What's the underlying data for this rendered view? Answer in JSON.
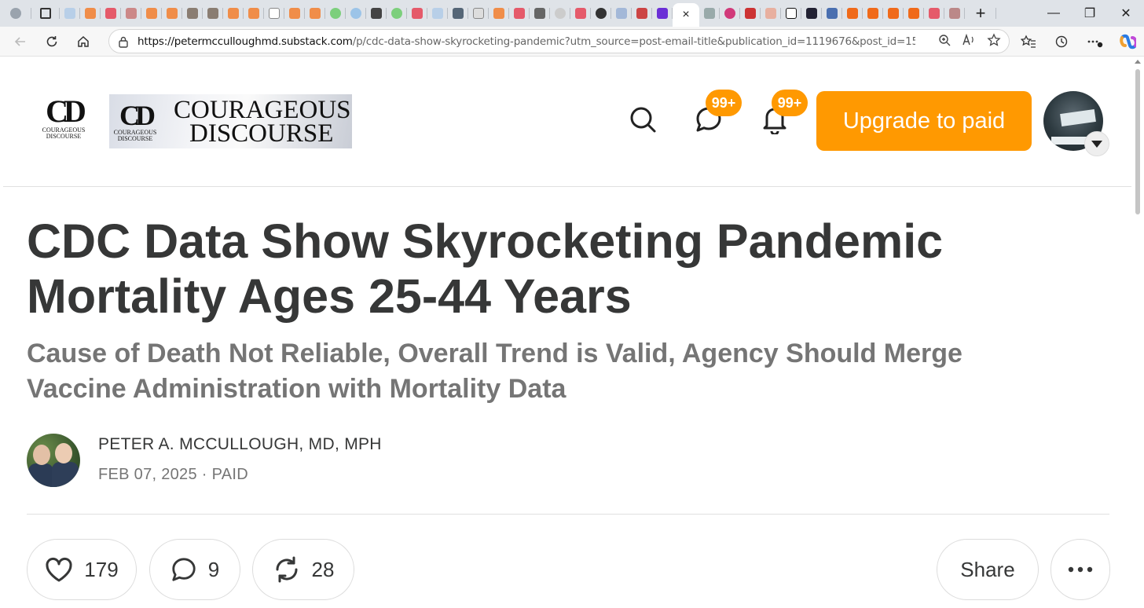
{
  "browser": {
    "url_host": "https://petermcculloughmd.substack.com",
    "url_path": "/p/cdc-data-show-skyrocketing-pandemic?utm_source=post-email-title&publication_id=1119676&post_id=156213578&ut...",
    "active_tab_close": "×",
    "new_tab": "+"
  },
  "header": {
    "logo_mark": "CD",
    "logo_caption_line1": "COURAGEOUS",
    "logo_caption_line2": "DISCOURSE",
    "banner_line1": "COURAGEOUS",
    "banner_line2": "DISCOURSE",
    "chat_badge": "99+",
    "notif_badge": "99+",
    "upgrade_label": "Upgrade to paid"
  },
  "post": {
    "title": "CDC Data Show Skyrocketing Pandemic Mortality Ages 25-44 Years",
    "subtitle": "Cause of Death Not Reliable, Overall Trend is Valid, Agency Should Merge Vaccine Administration with Mortality Data",
    "author": "PETER A. MCCULLOUGH, MD, MPH",
    "meta": "FEB 07, 2025 · PAID"
  },
  "actions": {
    "likes": "179",
    "comments": "9",
    "restacks": "28",
    "share_label": "Share"
  },
  "colors": {
    "accent": "#ff9901",
    "text": "#363737",
    "muted": "#757575"
  }
}
